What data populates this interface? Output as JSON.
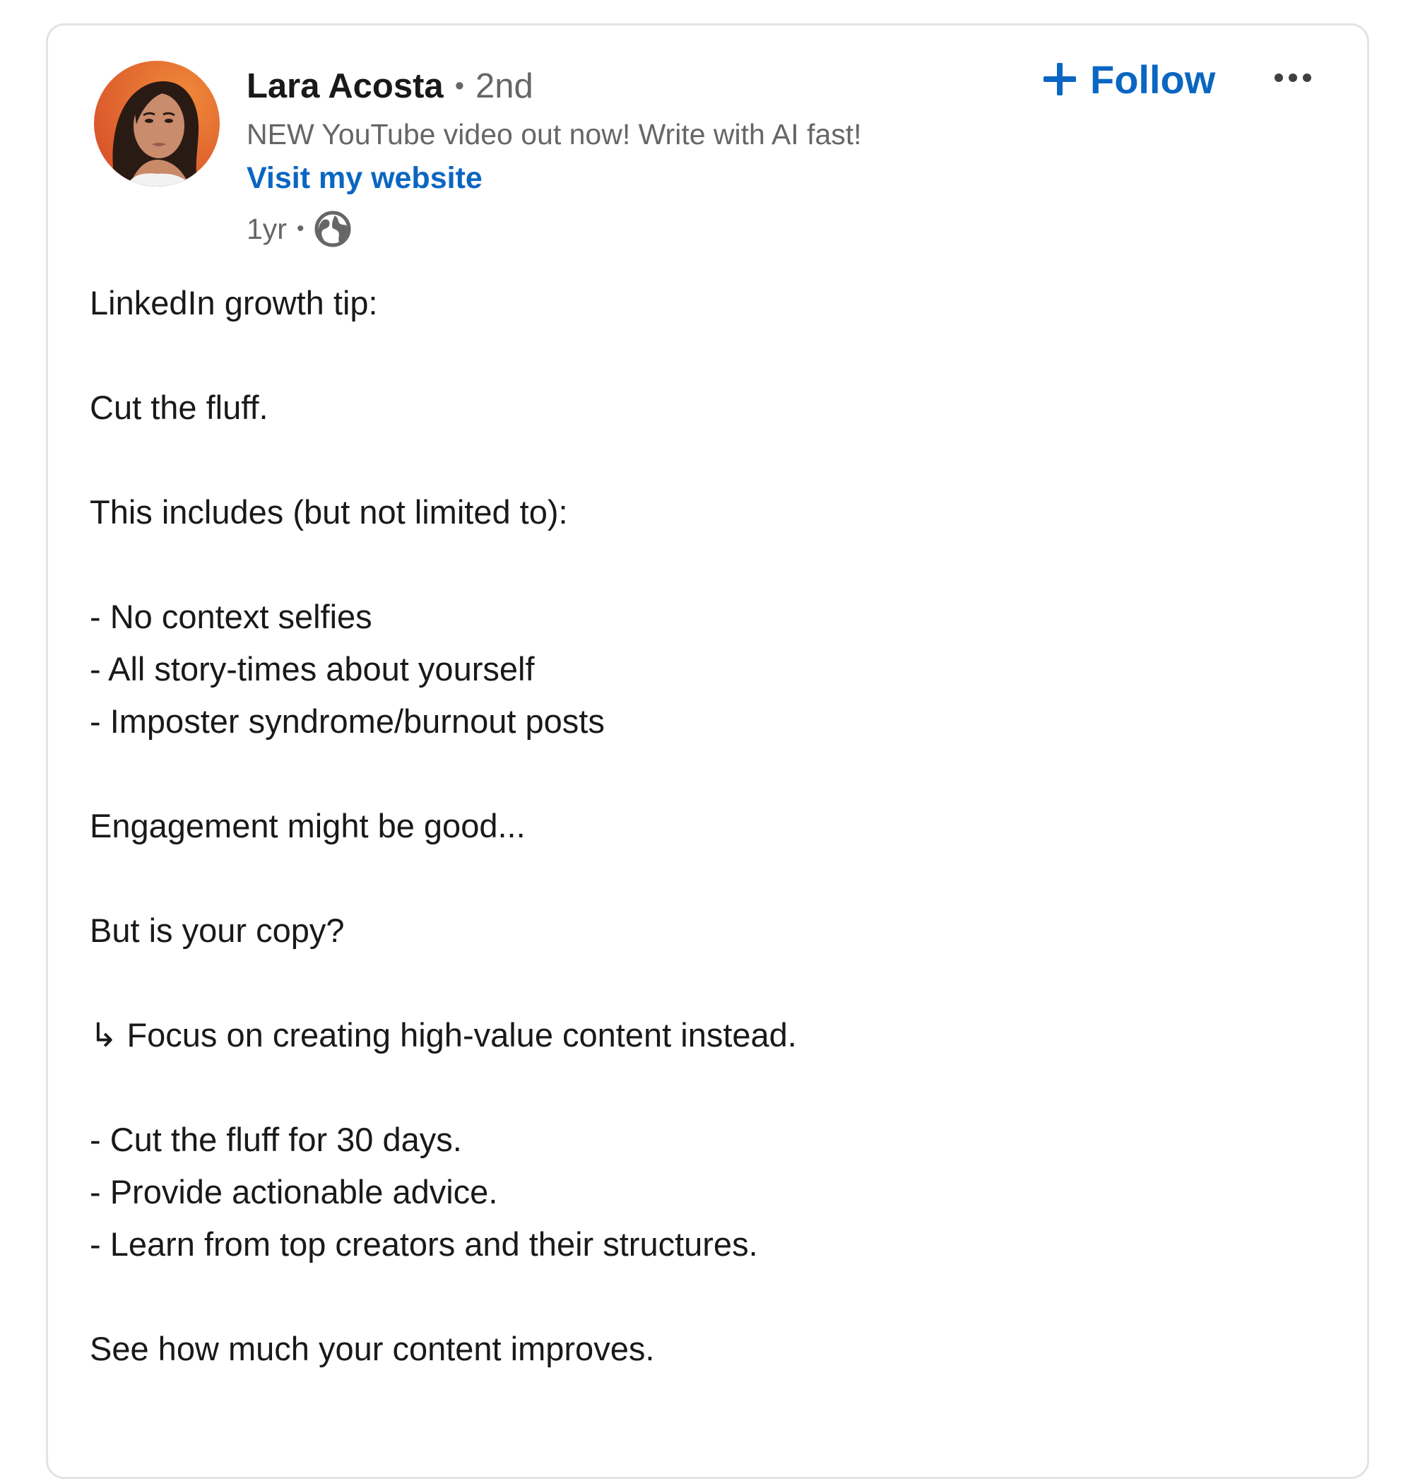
{
  "author": {
    "name": "Lara Acosta",
    "separator": "•",
    "degree": "2nd",
    "headline": "NEW YouTube video out now! Write with AI fast!",
    "website_link": "Visit my website"
  },
  "meta": {
    "time": "1yr",
    "separator": "•",
    "visibility_icon": "globe-icon"
  },
  "actions": {
    "follow_label": "Follow",
    "follow_icon": "plus-icon",
    "more_icon": "ellipsis-icon"
  },
  "post": {
    "lines": [
      "LinkedIn growth tip:",
      "",
      "Cut the fluff.",
      "",
      "This includes (but not limited to):",
      "",
      "- No context selfies",
      "- All story-times about yourself",
      "- Imposter syndrome/burnout posts",
      "",
      "Engagement might be good...",
      "",
      "But is your copy?",
      "",
      "↳ Focus on creating high-value content instead.",
      "",
      "- Cut the fluff for 30 days.",
      "- Provide actionable advice.",
      "- Learn from top creators and their structures.",
      "",
      "See how much your content improves."
    ]
  },
  "colors": {
    "link_blue": "#0a66c2",
    "text_primary": "#191919",
    "text_secondary": "#666666",
    "card_border": "#e3e3e3"
  }
}
